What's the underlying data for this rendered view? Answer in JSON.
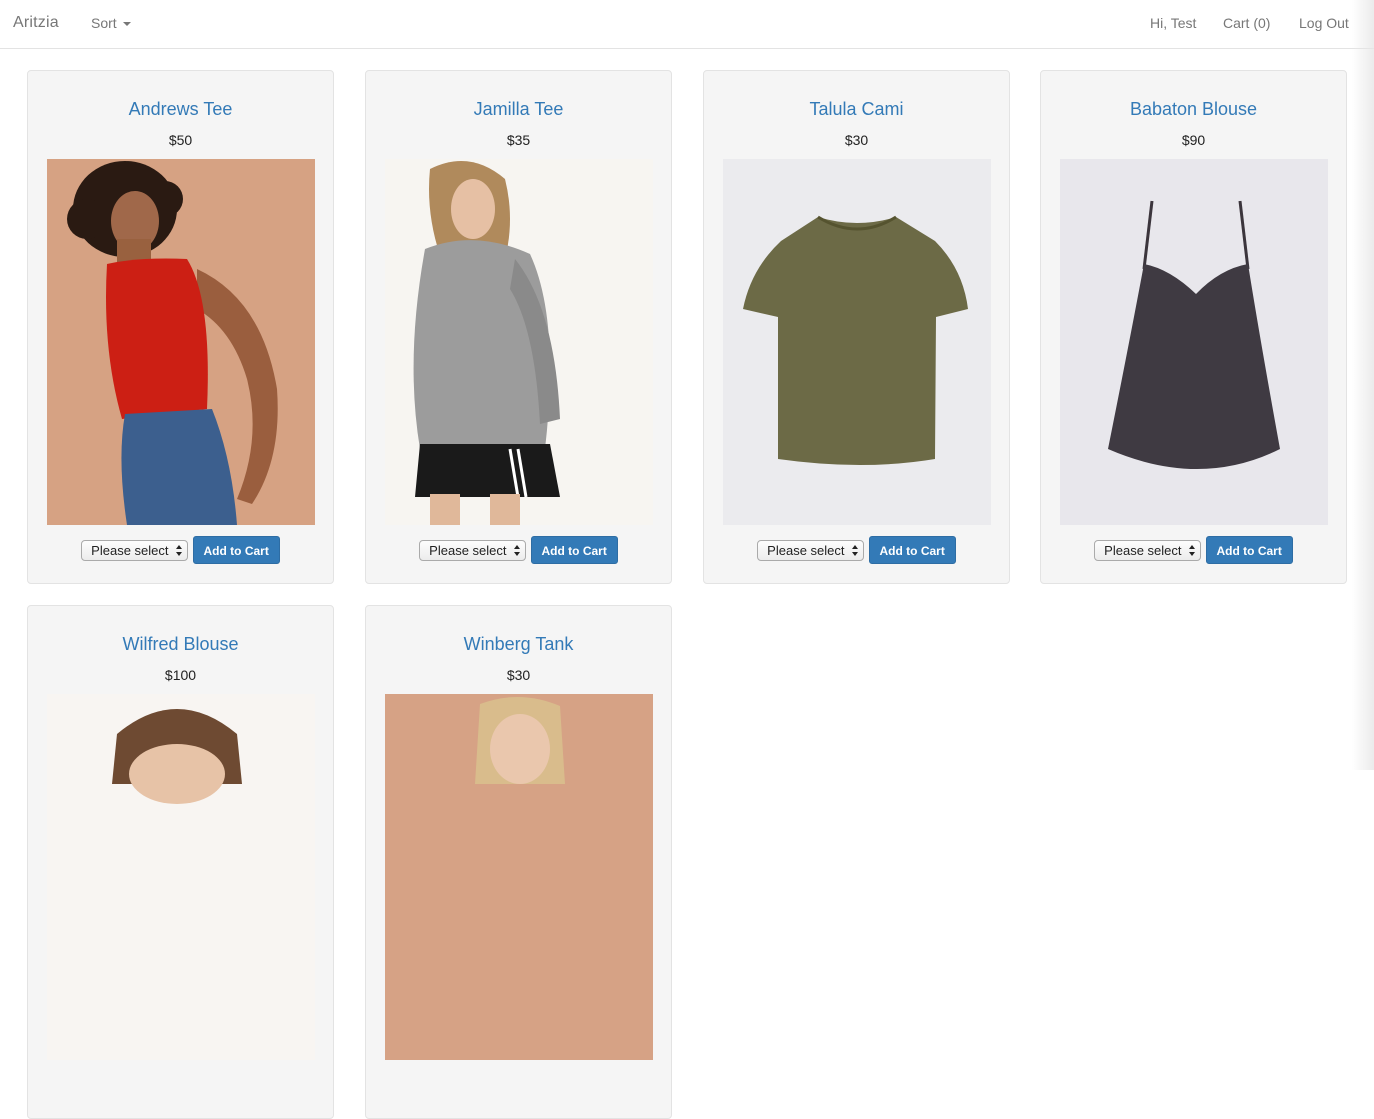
{
  "navbar": {
    "brand": "Aritzia",
    "sort_label": "Sort",
    "greeting": "Hi, Test",
    "cart": "Cart (0)",
    "logout": "Log Out"
  },
  "products": [
    {
      "name": "Andrews Tee",
      "price": "$50",
      "select": "Please select",
      "button": "Add to Cart"
    },
    {
      "name": "Jamilla Tee",
      "price": "$35",
      "select": "Please select",
      "button": "Add to Cart"
    },
    {
      "name": "Talula Cami",
      "price": "$30",
      "select": "Please select",
      "button": "Add to Cart"
    },
    {
      "name": "Babaton Blouse",
      "price": "$90",
      "select": "Please select",
      "button": "Add to Cart"
    },
    {
      "name": "Wilfred Blouse",
      "price": "$100"
    },
    {
      "name": "Winberg Tank",
      "price": "$30"
    }
  ],
  "colors": {
    "link": "#337ab7",
    "card_bg": "#f5f5f5",
    "card_border": "#e3e3e3",
    "button_bg": "#337ab7"
  }
}
